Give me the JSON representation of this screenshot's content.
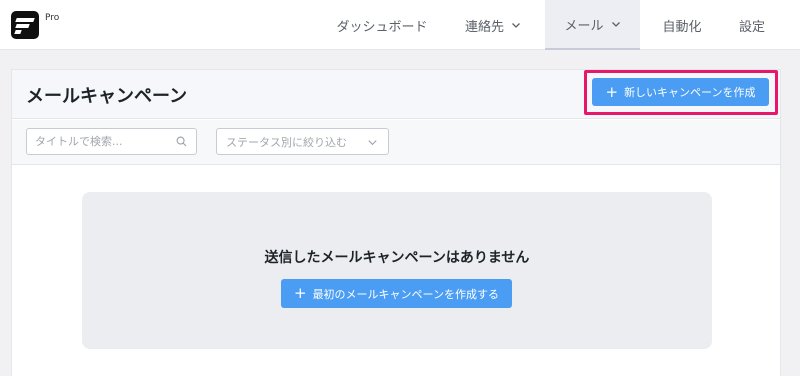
{
  "app": {
    "badge": "Pro"
  },
  "nav": {
    "items": [
      {
        "label": "ダッシュボード"
      },
      {
        "label": "連絡先"
      },
      {
        "label": "メール"
      },
      {
        "label": "自動化"
      },
      {
        "label": "設定"
      }
    ],
    "active_index": 2
  },
  "page": {
    "title": "メールキャンペーン",
    "new_campaign_button": "新しいキャンペーンを作成"
  },
  "filters": {
    "search_placeholder": "タイトルで検索...",
    "status_filter_label": "ステータス別に絞り込む"
  },
  "empty_state": {
    "message": "送信したメールキャンペーンはありません",
    "create_first_button": "最初のメールキャンペーンを作成する"
  },
  "colors": {
    "accent": "#4a9df2",
    "highlight": "#e8176a"
  },
  "icons": {
    "plus": "plus-icon",
    "search": "search-icon",
    "chevron": "chevron-down-icon"
  }
}
